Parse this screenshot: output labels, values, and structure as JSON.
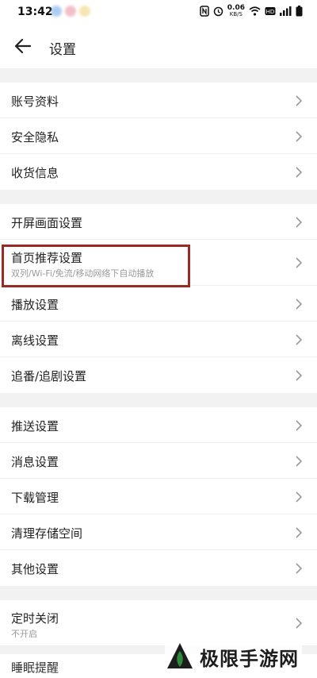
{
  "status": {
    "time": "13:42",
    "net_speed": "0.06",
    "net_unit": "KB/S"
  },
  "header": {
    "title": "设置"
  },
  "groups": [
    {
      "items": [
        {
          "label": "账号资料"
        },
        {
          "label": "安全隐私"
        },
        {
          "label": "收货信息"
        }
      ]
    },
    {
      "items": [
        {
          "label": "开屏画面设置"
        },
        {
          "label": "首页推荐设置",
          "sub": "双列/Wi-Fi/免流/移动网络下自动播放"
        },
        {
          "label": "播放设置"
        },
        {
          "label": "离线设置"
        },
        {
          "label": "追番/追剧设置"
        }
      ]
    },
    {
      "items": [
        {
          "label": "推送设置"
        },
        {
          "label": "消息设置"
        },
        {
          "label": "下载管理"
        },
        {
          "label": "清理存储空间"
        },
        {
          "label": "其他设置"
        }
      ]
    },
    {
      "items": [
        {
          "label": "定时关闭",
          "sub": "不开启"
        },
        {
          "label": "睡眠提醒"
        }
      ]
    }
  ],
  "watermark": {
    "text": "极限手游网"
  },
  "colors": {
    "highlight": "#9a2a24",
    "watermark_green": "#2e8b3a"
  }
}
